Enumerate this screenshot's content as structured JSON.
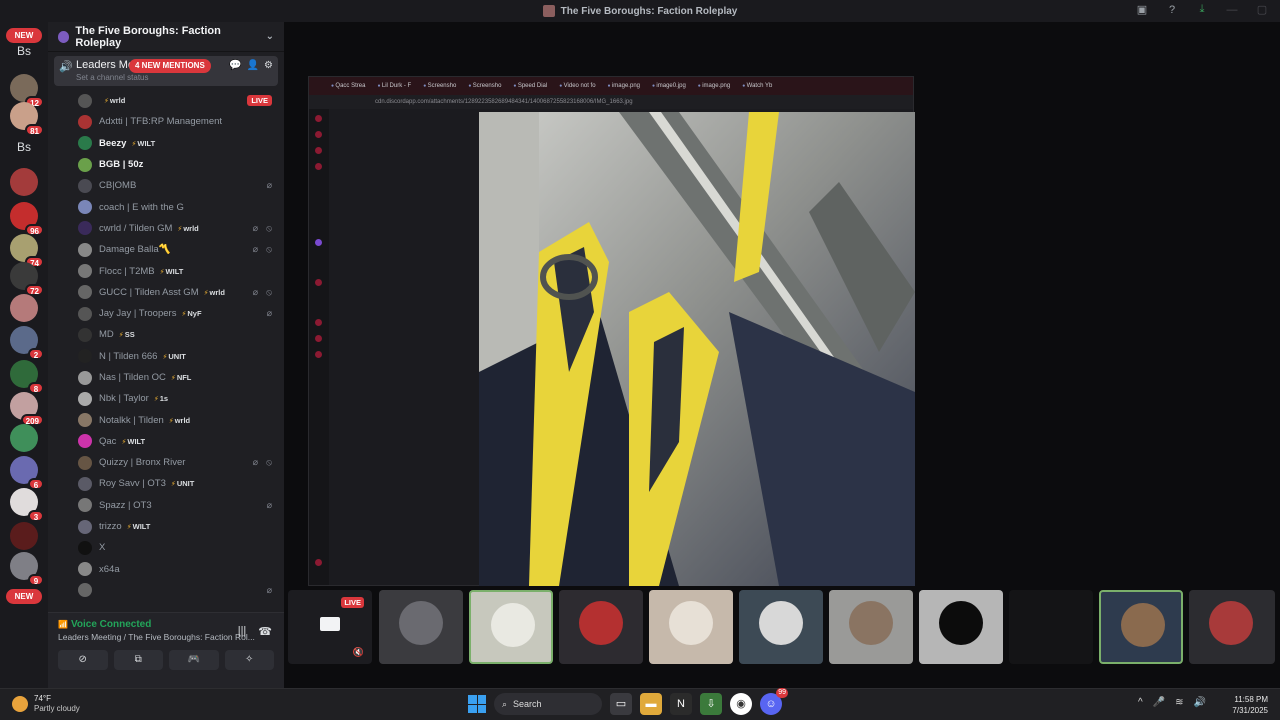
{
  "window": {
    "title": "The Five Boroughs: Faction Roleplay"
  },
  "rail": {
    "new_top": "NEW",
    "new_bottom": "NEW",
    "text_servers": [
      "Bs",
      "Bs"
    ],
    "badges": [
      "12",
      "81",
      "96",
      "74",
      "72",
      "2",
      "8",
      "209",
      "6",
      "3",
      "9"
    ]
  },
  "server": {
    "name": "The Five Boroughs: Faction Roleplay",
    "channel_name": "Leaders Me",
    "channel_status": "Set a channel status",
    "mentions_pill": "4 NEW MENTIONS"
  },
  "members": [
    {
      "name": "",
      "tag": "wrld",
      "live": "LIVE",
      "bright": false
    },
    {
      "name": "Adxtti | TFB:RP Management",
      "tag": "",
      "bright": false
    },
    {
      "name": "Beezy",
      "tag": "WILT",
      "bright": true
    },
    {
      "name": "BGB | 50z",
      "tag": "",
      "bright": true
    },
    {
      "name": "CB|OMB",
      "tag": "",
      "mute": true
    },
    {
      "name": "coach | E with the G",
      "tag": ""
    },
    {
      "name": "cwrld / Tilden GM",
      "tag": "wrld",
      "mute": true,
      "deaf": true
    },
    {
      "name": "Damage Balla〽️",
      "tag": "",
      "mute": true,
      "deaf": true
    },
    {
      "name": "Flocc | T2MB",
      "tag": "WILT"
    },
    {
      "name": "GUCC | Tilden Asst GM",
      "tag": "wrld",
      "mute": true,
      "deaf": true
    },
    {
      "name": "Jay Jay | Troopers",
      "tag": "NyF",
      "mute": true
    },
    {
      "name": "MD",
      "tag": "SS"
    },
    {
      "name": "N | Tilden 666",
      "tag": "UNIT"
    },
    {
      "name": "Nas | Tilden OC",
      "tag": "NFL"
    },
    {
      "name": "Nbk | Taylor",
      "tag": "1s"
    },
    {
      "name": "Notalkk | Tilden",
      "tag": "wrld"
    },
    {
      "name": "Qac",
      "tag": "WILT"
    },
    {
      "name": "Quizzy | Bronx River",
      "tag": "",
      "mute": true,
      "deaf": true
    },
    {
      "name": "Roy Savv | OT3",
      "tag": "UNIT"
    },
    {
      "name": "Spazz | OT3",
      "tag": "",
      "mute": true
    },
    {
      "name": "trizzo",
      "tag": "WILT"
    },
    {
      "name": "X",
      "tag": ""
    },
    {
      "name": "x64a",
      "tag": ""
    },
    {
      "name": "",
      "tag": "",
      "mute": true
    }
  ],
  "voice": {
    "status": "Voice Connected",
    "path": "Leaders Meeting / The Five Boroughs: Faction Rol..."
  },
  "browser": {
    "tabs": [
      "Qacc Strea",
      "Lil Durk - F",
      "Screensho",
      "Screensho",
      "Speed Dial",
      "Video not fo",
      "image.png",
      "image0.jpg",
      "image.png",
      "Watch Yb"
    ],
    "url": "cdn.discordapp.com/attachments/1289223582689484341/1400687255823168006/IMG_1663.jpg"
  },
  "strip": {
    "live_label": "LIVE"
  },
  "taskbar": {
    "temp": "74°F",
    "weather": "Partly cloudy",
    "search_placeholder": "Search",
    "time": "11:58 PM",
    "date": "7/31/2025",
    "discord_badge": "99"
  },
  "colors": {
    "accent_red": "#da373c",
    "voice_green": "#23a55a",
    "selected_tile": "#7bb06b",
    "graffiti_yellow": "#e8d43a"
  }
}
